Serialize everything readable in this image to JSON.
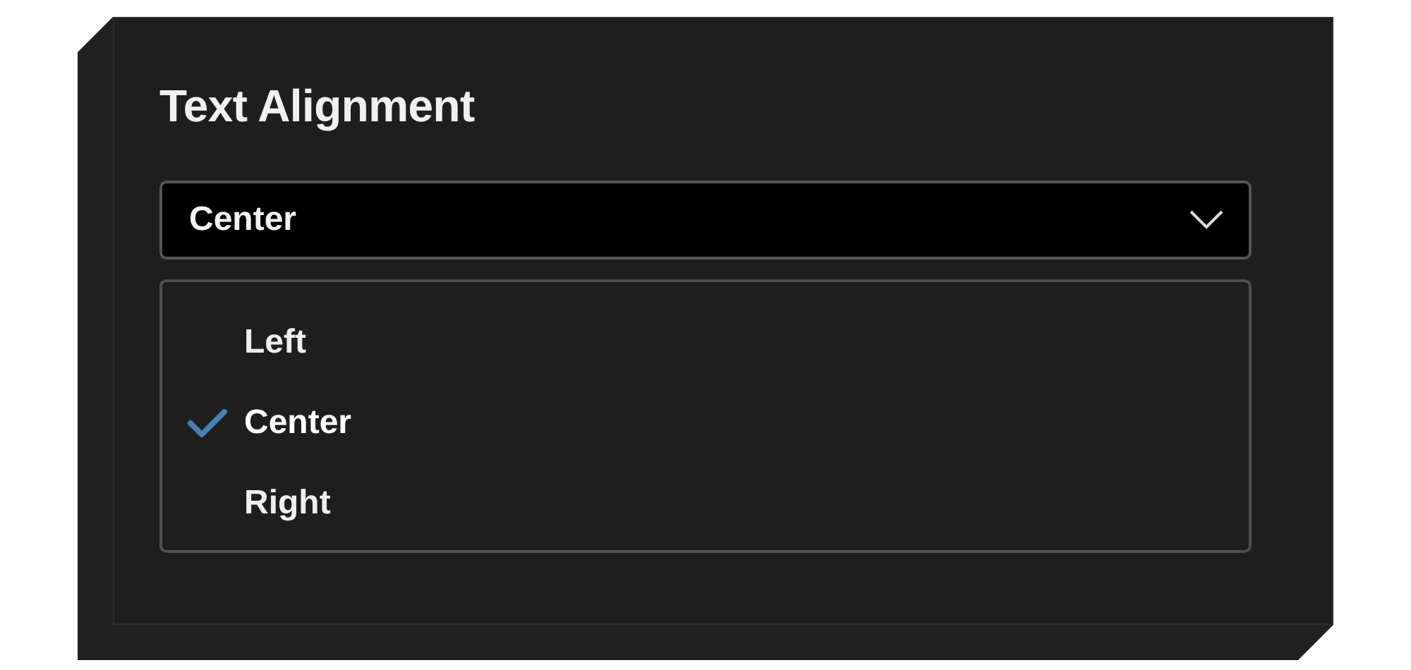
{
  "title": "Text Alignment",
  "select": {
    "value": "Center",
    "expanded": true
  },
  "options": [
    {
      "label": "Left",
      "selected": false
    },
    {
      "label": "Center",
      "selected": true
    },
    {
      "label": "Right",
      "selected": false
    }
  ]
}
